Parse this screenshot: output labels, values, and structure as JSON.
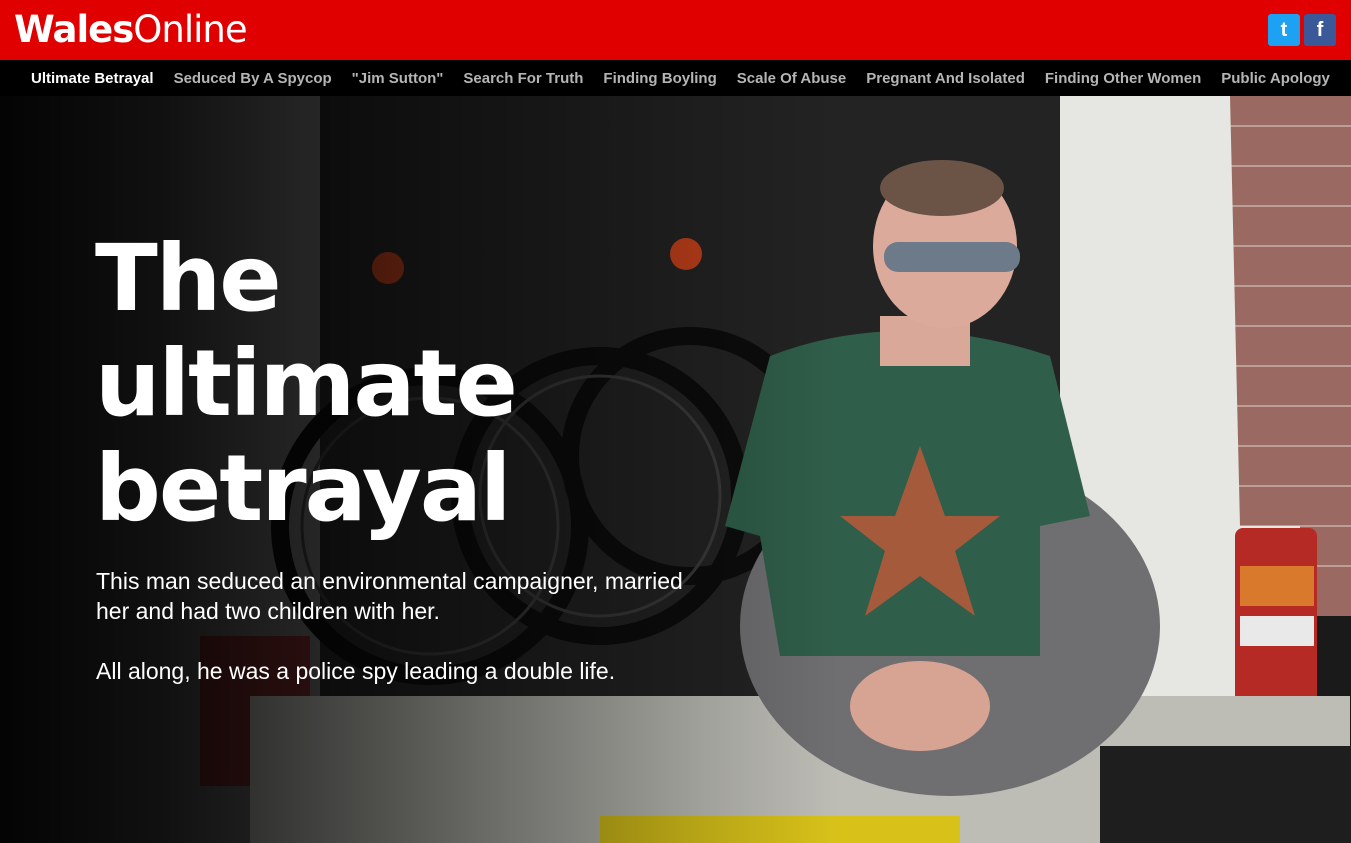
{
  "brand": {
    "logo_bold": "Wales",
    "logo_light": "Online",
    "color": "#e00000"
  },
  "social": {
    "twitter_icon": "twitter-icon",
    "facebook_icon": "facebook-icon",
    "twitter_glyph": "t",
    "facebook_glyph": "f"
  },
  "nav": {
    "items": [
      {
        "label": "Ultimate Betrayal"
      },
      {
        "label": "Seduced By A Spycop"
      },
      {
        "label": "\"Jim Sutton\""
      },
      {
        "label": "Search For Truth"
      },
      {
        "label": "Finding Boyling"
      },
      {
        "label": "Scale Of Abuse"
      },
      {
        "label": "Pregnant And Isolated"
      },
      {
        "label": "Finding Other Women"
      },
      {
        "label": "Public Apology"
      }
    ]
  },
  "hero": {
    "headline_line1": "The",
    "headline_line2": "ultimate",
    "headline_line3": "betrayal",
    "intro_1": "This man seduced an environmental campaigner, married her and had two children with her.",
    "intro_2": "All along, he was a police spy leading a double life."
  }
}
